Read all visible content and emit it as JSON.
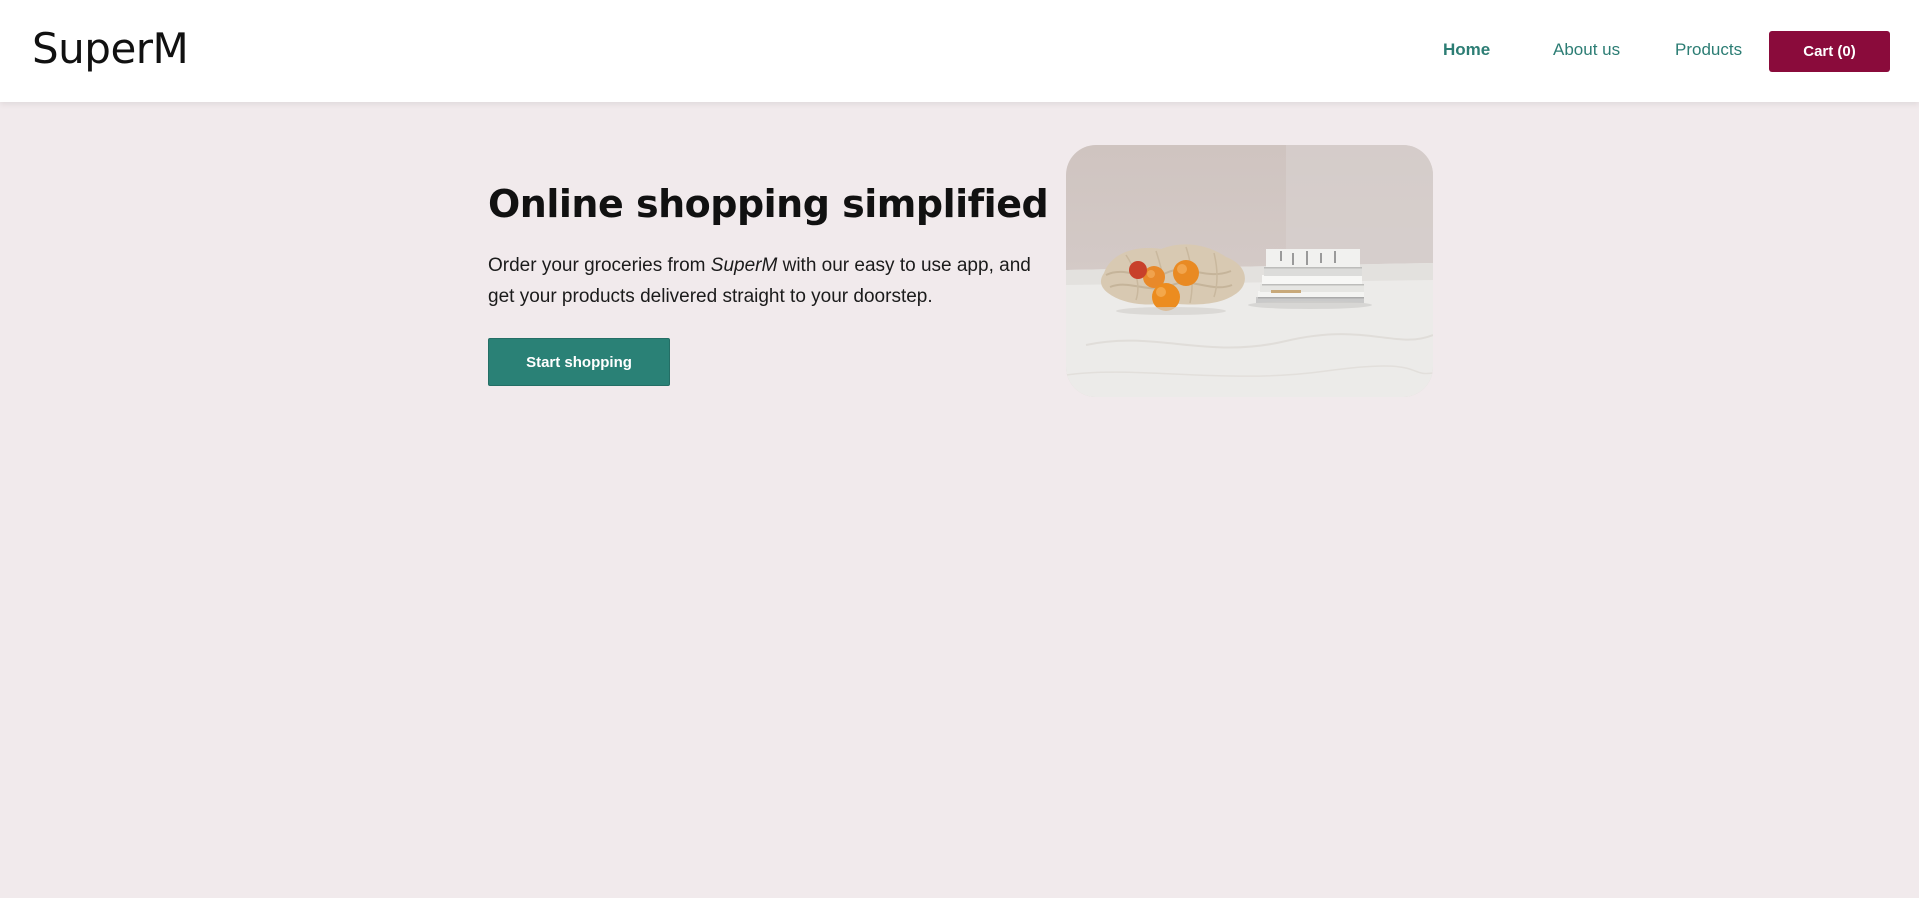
{
  "header": {
    "logo": "SuperM",
    "nav": {
      "home": "Home",
      "about": "About us",
      "products": "Products"
    },
    "cart_label": "Cart (0)"
  },
  "hero": {
    "title": "Online shopping simplified",
    "description_prefix": "Order your groceries from ",
    "description_brand": "SuperM",
    "description_suffix": " with our easy to use app, and get your products delivered straight to your doorstep.",
    "cta_label": "Start shopping",
    "image_alt": "groceries-illustration"
  },
  "colors": {
    "page_bg": "#f1eaec",
    "accent_teal": "#2a8176",
    "cart_magenta": "#8a0b3b",
    "nav_link": "#2c7d74"
  }
}
